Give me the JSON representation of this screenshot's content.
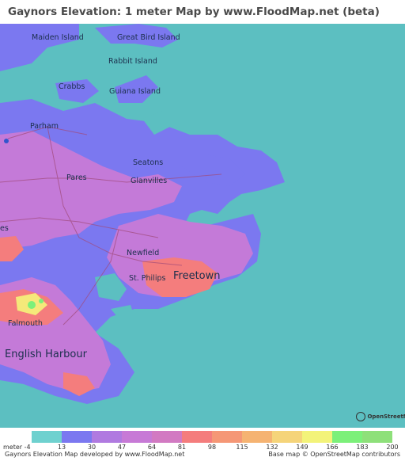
{
  "title": "Gaynors Elevation: 1 meter Map by www.FloodMap.net (beta)",
  "colors": {
    "sea": "#5cbfc1",
    "low": "#7b78f0",
    "mid": "#c07ad8",
    "high": "#f47d7d",
    "peak": "#f5e97a"
  },
  "places": [
    {
      "name": "Maiden Island",
      "size": "small"
    },
    {
      "name": "Great Bird Island",
      "size": "small"
    },
    {
      "name": "Rabbit Island",
      "size": "small"
    },
    {
      "name": "Crabbs",
      "size": "small"
    },
    {
      "name": "Guiana Island",
      "size": "small"
    },
    {
      "name": "Parham",
      "size": "small"
    },
    {
      "name": "Seatons",
      "size": "small"
    },
    {
      "name": "Pares",
      "size": "small"
    },
    {
      "name": "Glanvilles",
      "size": "small"
    },
    {
      "name": "es",
      "size": "small"
    },
    {
      "name": "Newfield",
      "size": "small"
    },
    {
      "name": "St. Philips",
      "size": "small"
    },
    {
      "name": "Freetown",
      "size": "big"
    },
    {
      "name": "Falmouth",
      "size": "small"
    },
    {
      "name": "English Harbour",
      "size": "big"
    }
  ],
  "osm_badge": "OpenStreetMap",
  "legend": {
    "colors": [
      "#6fd1cf",
      "#7b78f0",
      "#b07ae0",
      "#c77ad6",
      "#d27ac2",
      "#f47d7d",
      "#f59776",
      "#f5b372",
      "#f5d47a",
      "#f3f37a",
      "#7cf07a",
      "#8ee07a"
    ],
    "labels": [
      "meter -4",
      "13",
      "30",
      "47",
      "64",
      "81",
      "98",
      "115",
      "132",
      "149",
      "166",
      "183",
      "200"
    ]
  },
  "footer": {
    "left": "Gaynors Elevation Map developed by www.FloodMap.net",
    "right": "Base map © OpenStreetMap contributors"
  }
}
